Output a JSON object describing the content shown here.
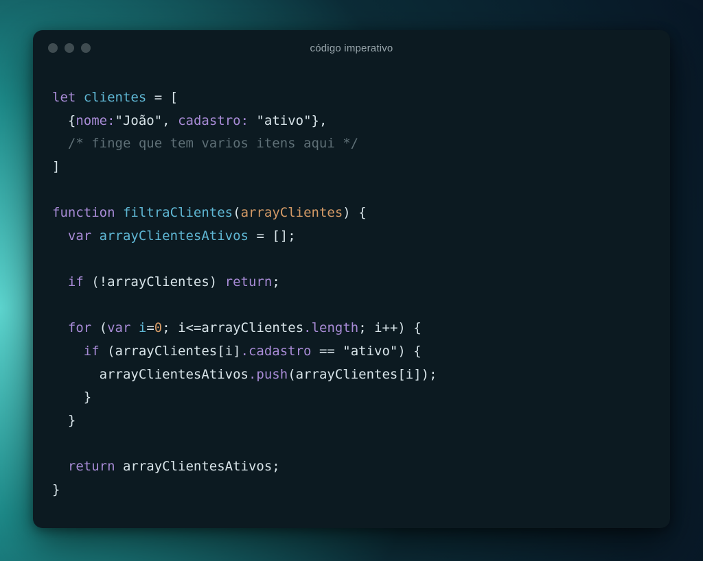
{
  "window": {
    "title": "código imperativo"
  },
  "code": {
    "l1_let": "let",
    "l1_var": "clientes",
    "l1_rest": " = [",
    "l2_a": "  {",
    "l2_nome": "nome:",
    "l2_str1": "\"João\"",
    "l2_sep": ", ",
    "l2_cad": "cadastro:",
    "l2_sp": " ",
    "l2_str2": "\"ativo\"",
    "l2_end": "},",
    "l3_cm": "  /* finge que tem varios itens aqui */",
    "l4": "]",
    "blank": "",
    "l6_fn": "function",
    "l6_sp": " ",
    "l6_name": "filtraClientes",
    "l6_op": "(",
    "l6_param": "arrayClientes",
    "l6_cl": ") {",
    "l7_var": "  var",
    "l7_sp": " ",
    "l7_name": "arrayClientesAtivos",
    "l7_rest": " = [];",
    "l9_if": "  if",
    "l9_rest_a": " (!arrayClientes) ",
    "l9_ret": "return",
    "l9_semi": ";",
    "l11_for": "  for",
    "l11_a": " (",
    "l11_var": "var",
    "l11_b": " ",
    "l11_i": "i",
    "l11_c": "=",
    "l11_zero": "0",
    "l11_d": "; i<=arrayClientes",
    "l11_len": ".length",
    "l11_e": "; i++) {",
    "l12_if": "    if",
    "l12_a": " (arrayClientes[i]",
    "l12_cad": ".cadastro",
    "l12_b": " == ",
    "l12_str": "\"ativo\"",
    "l12_c": ") {",
    "l13_a": "      arrayClientesAtivos",
    "l13_push": ".push",
    "l13_b": "(arrayClientes[i]);",
    "l14": "    }",
    "l15": "  }",
    "l17_ret": "  return",
    "l17_rest": " arrayClientesAtivos;",
    "l18": "}"
  }
}
